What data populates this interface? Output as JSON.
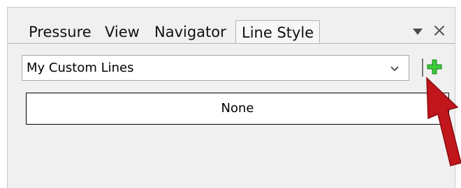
{
  "tabs": [
    {
      "label": "Pressure",
      "active": false
    },
    {
      "label": "View",
      "active": false
    },
    {
      "label": "Navigator",
      "active": false
    },
    {
      "label": "Line Style",
      "active": true
    }
  ],
  "tab_controls": {
    "menu_icon": "triangle-down-icon",
    "close_icon": "close-icon",
    "close_glyph": "×"
  },
  "line_style": {
    "selected_preset": "My Custom Lines",
    "add_button_icon": "plus-icon",
    "selected_item": "None"
  },
  "annotation": {
    "icon": "red-arrow-icon",
    "color": "#c0161c"
  },
  "colors": {
    "add_icon_green": "#2fb52f",
    "panel_bg": "#f0f0f0"
  }
}
